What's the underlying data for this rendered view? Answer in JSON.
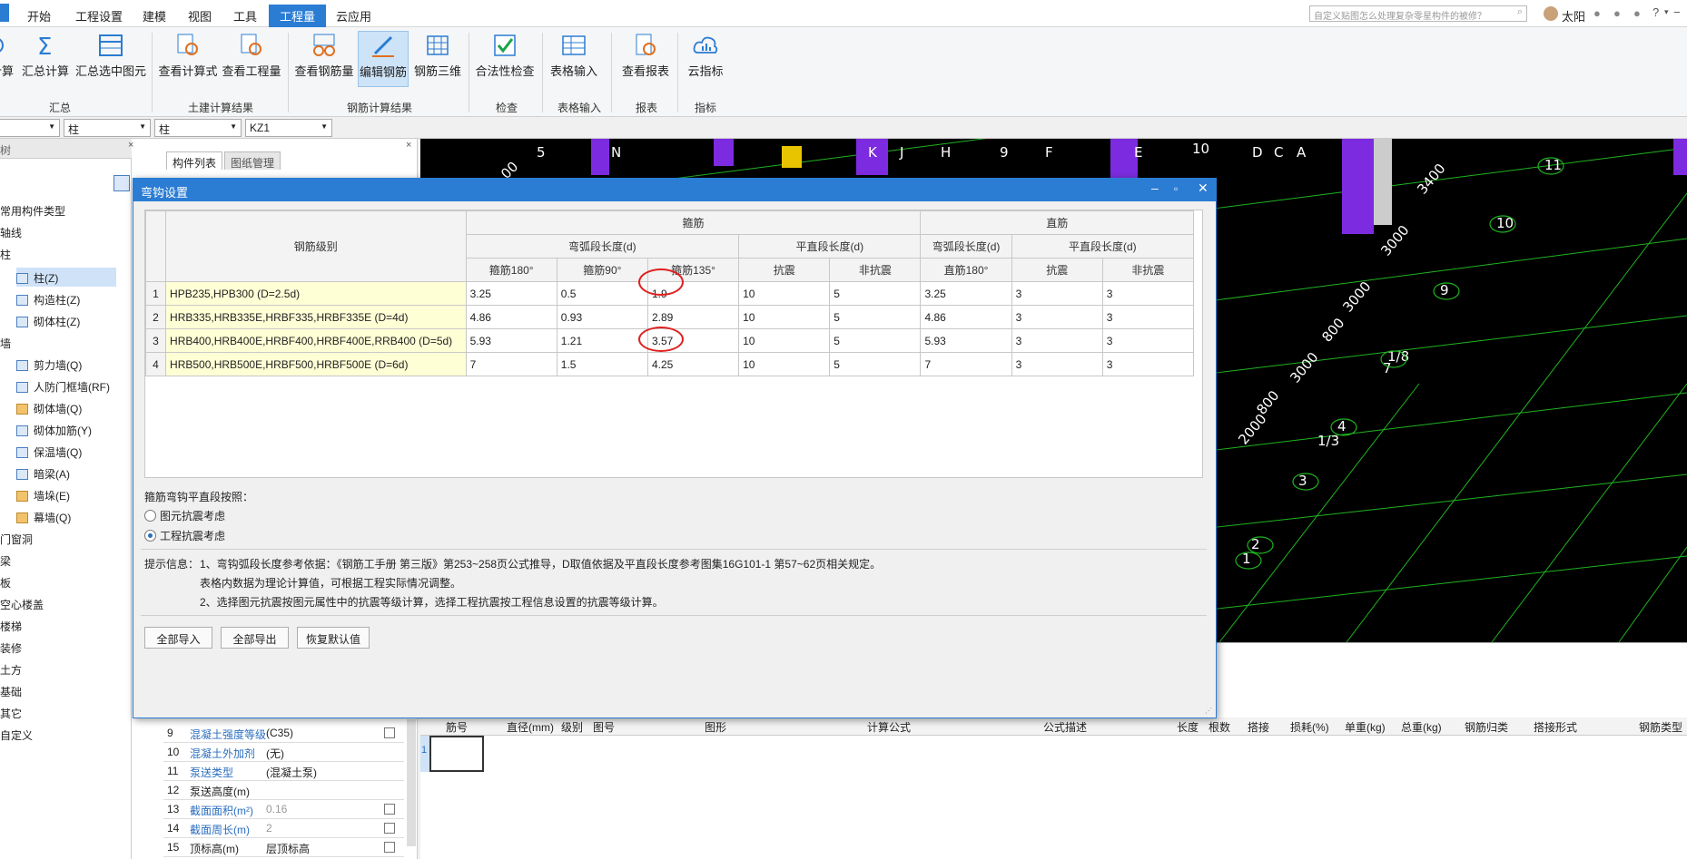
{
  "menu": {
    "items": [
      "开始",
      "工程设置",
      "建模",
      "视图",
      "工具",
      "工程量",
      "云应用"
    ],
    "active": "工程量",
    "search_placeholder": "自定义贴图怎么处理复杂零星构件的被修？",
    "user": "太阳"
  },
  "ribbon": {
    "buttons": [
      {
        "label": "计算",
        "icon": "cloud-calc-icon"
      },
      {
        "label": "汇总计算",
        "icon": "sigma-icon"
      },
      {
        "label": "汇总选中图元",
        "icon": "table-sum-icon"
      },
      {
        "label": "查看计算式",
        "icon": "formula-view-icon"
      },
      {
        "label": "查看工程量",
        "icon": "quantity-view-icon"
      },
      {
        "label": "查看钢筋量",
        "icon": "rebar-glasses-icon"
      },
      {
        "label": "编辑钢筋",
        "icon": "pen-edit-icon"
      },
      {
        "label": "钢筋三维",
        "icon": "rebar-3d-icon"
      },
      {
        "label": "合法性检查",
        "icon": "check-icon"
      },
      {
        "label": "表格输入",
        "icon": "table-input-icon"
      },
      {
        "label": "查看报表",
        "icon": "report-icon"
      },
      {
        "label": "云指标",
        "icon": "cloud-index-icon"
      }
    ],
    "groups": [
      "汇总",
      "土建计算结果",
      "钢筋计算结果",
      "检查",
      "表格输入",
      "报表",
      "指标"
    ]
  },
  "selectors": [
    "",
    "柱",
    "柱",
    "KZ1"
  ],
  "tree": {
    "header": "树",
    "items": [
      "常用构件类型",
      "轴线",
      "柱",
      "墙",
      "门窗洞",
      "梁",
      "板",
      "空心楼盖",
      "楼梯",
      "装修",
      "土方",
      "基础",
      "其它",
      "自定义"
    ],
    "column_children": [
      "柱(Z)",
      "构造柱(Z)",
      "砌体柱(Z)"
    ],
    "wall_children": [
      "剪力墙(Q)",
      "人防门框墙(RF)",
      "砌体墙(Q)",
      "砌体加筋(Y)",
      "保温墙(Q)",
      "暗梁(A)",
      "墙垛(E)",
      "幕墙(Q)"
    ]
  },
  "middle_tabs": [
    "构件列表",
    "图纸管理"
  ],
  "properties": [
    {
      "no": "9",
      "name": "混凝土强度等级",
      "value": "(C35)",
      "link": true
    },
    {
      "no": "10",
      "name": "混凝土外加剂",
      "value": "(无)",
      "link": true
    },
    {
      "no": "11",
      "name": "泵送类型",
      "value": "(混凝土泵)",
      "link": true
    },
    {
      "no": "12",
      "name": "泵送高度(m)",
      "value": "",
      "link": false
    },
    {
      "no": "13",
      "name": "截面面积(m²)",
      "value": "0.16",
      "link": true
    },
    {
      "no": "14",
      "name": "截面周长(m)",
      "value": "2",
      "link": true
    },
    {
      "no": "15",
      "name": "顶标高(m)",
      "value": "层顶标高",
      "link": false
    }
  ],
  "cad_labels": {
    "axis_top": [
      "5",
      "N",
      "K",
      "J",
      "H",
      "9",
      "F",
      "E",
      "10",
      "D",
      "C",
      "A"
    ],
    "right_axes": [
      "11",
      "10",
      "9",
      "1/8",
      "7",
      "4",
      "1/3",
      "3",
      "2",
      "1"
    ],
    "dims": [
      "3400",
      "3000",
      "3000",
      "800",
      "3000",
      "800",
      "2000"
    ],
    "small_dims": [
      "00",
      "00"
    ]
  },
  "bottom_grid_headers": [
    "筋号",
    "直径(mm)",
    "级别",
    "图号",
    "图形",
    "计算公式",
    "公式描述",
    "长度",
    "根数",
    "搭接",
    "损耗(%)",
    "单重(kg)",
    "总重(kg)",
    "钢筋归类",
    "搭接形式",
    "钢筋类型"
  ],
  "bottom_grid_row_no": "1",
  "dialog": {
    "title": "弯钩设置",
    "headers": {
      "grade": "钢筋级别",
      "stirrup": "箍筋",
      "straight": "直筋",
      "hook_len": "弯弧段长度(d)",
      "flat_len": "平直段长度(d)",
      "cols": [
        "箍筋180°",
        "箍筋90°",
        "箍筋135°",
        "抗震",
        "非抗震",
        "直筋180°",
        "抗震",
        "非抗震"
      ]
    },
    "rows": [
      {
        "no": "1",
        "grade": "HPB235,HPB300 (D=2.5d)",
        "v": [
          "3.25",
          "0.5",
          "1.9",
          "10",
          "5",
          "3.25",
          "3",
          "3"
        ]
      },
      {
        "no": "2",
        "grade": "HRB335,HRB335E,HRBF335,HRBF335E (D=4d)",
        "v": [
          "4.86",
          "0.93",
          "2.89",
          "10",
          "5",
          "4.86",
          "3",
          "3"
        ]
      },
      {
        "no": "3",
        "grade": "HRB400,HRB400E,HRBF400,HRBF400E,RRB400 (D=5d)",
        "v": [
          "5.93",
          "1.21",
          "3.57",
          "10",
          "5",
          "5.93",
          "3",
          "3"
        ]
      },
      {
        "no": "4",
        "grade": "HRB500,HRB500E,HRBF500,HRBF500E (D=6d)",
        "v": [
          "7",
          "1.5",
          "4.25",
          "10",
          "5",
          "7",
          "3",
          "3"
        ]
      }
    ],
    "option_label": "箍筋弯钩平直段按照：",
    "options": [
      "图元抗震考虑",
      "工程抗震考虑"
    ],
    "selected_option": 1,
    "hint_label": "提示信息：",
    "hints": [
      "1、弯钩弧段长度参考依据：《钢筋工手册 第三版》第253~258页公式推导，D取值依据及平直段长度参考图集16G101-1 第57~62页相关规定。",
      "表格内数据为理论计算值，可根据工程实际情况调整。",
      "2、选择图元抗震按图元属性中的抗震等级计算，选择工程抗震按工程信息设置的抗震等级计算。"
    ],
    "buttons": [
      "全部导入",
      "全部导出",
      "恢复默认值"
    ]
  }
}
